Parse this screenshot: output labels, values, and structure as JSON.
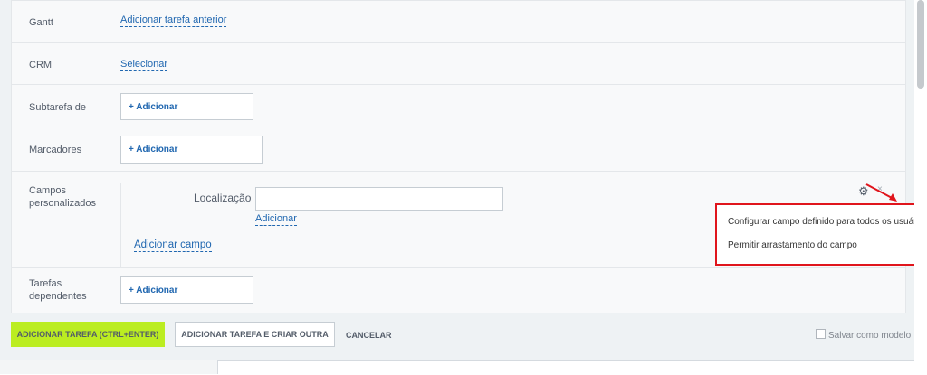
{
  "rows": {
    "gantt": {
      "label": "Gantt",
      "link": "Adicionar tarefa anterior"
    },
    "crm": {
      "label": "CRM",
      "link": "Selecionar"
    },
    "subtask": {
      "label": "Subtarefa de",
      "add": "+ Adicionar"
    },
    "tags": {
      "label": "Marcadores",
      "add": "+ Adicionar"
    },
    "custom_fields": {
      "label_line1": "Campos",
      "label_line2": "personalizados",
      "field_label": "Localização",
      "field_value": "",
      "field_add_link": "Adicionar",
      "add_field_link": "Adicionar campo"
    },
    "dependent": {
      "label_line1": "Tarefas",
      "label_line2": "dependentes",
      "add": "+ Adicionar"
    }
  },
  "context_menu": {
    "items": [
      "Configurar campo definido para todos os usuários",
      "Permitir arrastamento do campo"
    ]
  },
  "icons": {
    "gear": "gear-icon",
    "close": "close-icon",
    "arrow": "red-arrow-annotation"
  },
  "footer": {
    "primary_button": "ADICIONAR TAREFA (CTRL+ENTER)",
    "secondary_button": "ADICIONAR TAREFA E CRIAR OUTRA",
    "cancel_button": "CANCELAR",
    "save_template_label": "Salvar como modelo",
    "save_template_checked": false
  },
  "colors": {
    "accent": "#bbed21",
    "link": "#2067b0",
    "highlight": "#e0151c"
  }
}
